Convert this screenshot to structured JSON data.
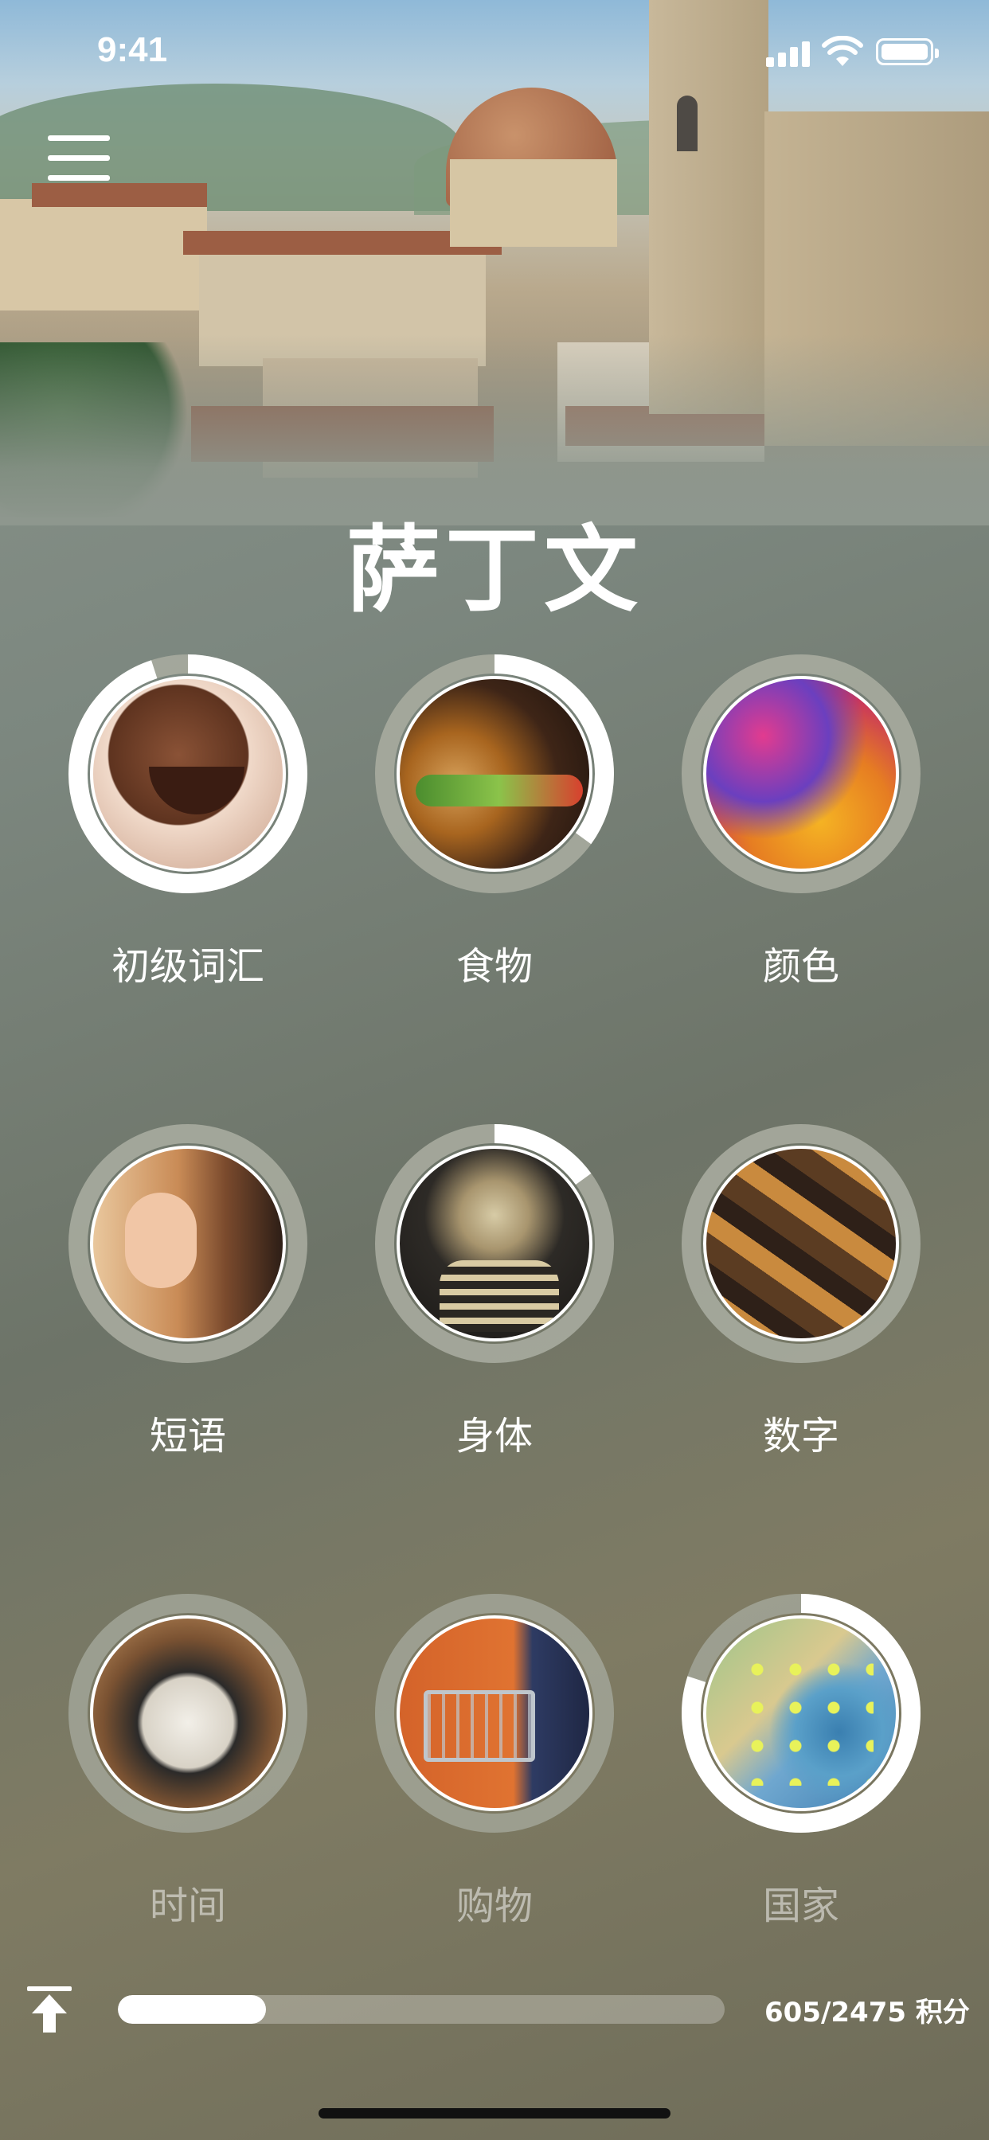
{
  "status_bar": {
    "time": "9:41"
  },
  "header": {
    "title": "萨丁文"
  },
  "topics": [
    {
      "label": "初级词汇",
      "progress": 0.95,
      "dimmed": false
    },
    {
      "label": "食物",
      "progress": 0.35,
      "dimmed": false
    },
    {
      "label": "颜色",
      "progress": 0.0,
      "dimmed": false
    },
    {
      "label": "短语",
      "progress": 0.0,
      "dimmed": false
    },
    {
      "label": "身体",
      "progress": 0.15,
      "dimmed": false
    },
    {
      "label": "数字",
      "progress": 0.0,
      "dimmed": false
    },
    {
      "label": "时间",
      "progress": 0.0,
      "dimmed": true
    },
    {
      "label": "购物",
      "progress": 0.0,
      "dimmed": true
    },
    {
      "label": "国家",
      "progress": 0.8,
      "dimmed": true
    }
  ],
  "footer": {
    "score_text": "605/2475 积分",
    "progress": 0.244
  },
  "colors": {
    "ring_track": "#a7ab9f",
    "ring_fill": "#ffffff"
  }
}
